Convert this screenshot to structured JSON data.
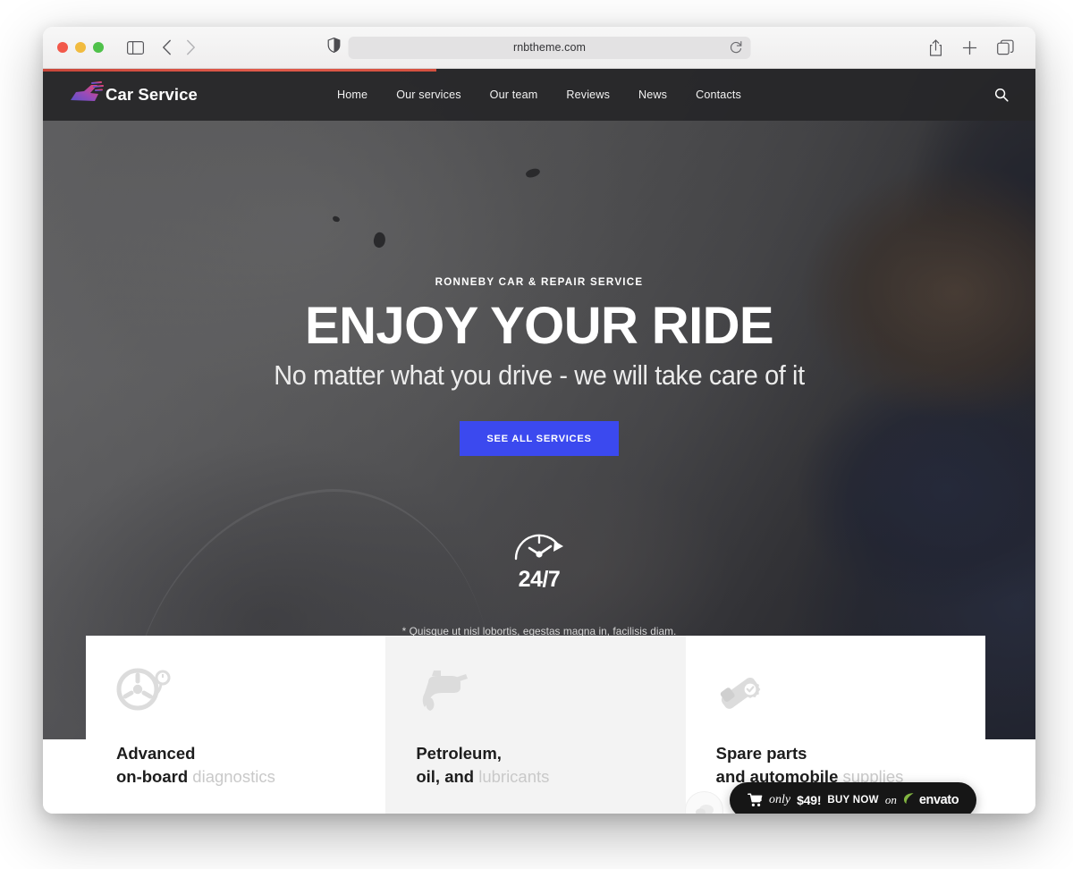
{
  "browser": {
    "url": "rnbtheme.com",
    "icons": {
      "sidebar": "sidebar-toggle-icon",
      "back": "back-chevron-icon",
      "forward": "forward-chevron-icon",
      "privacy": "privacy-report-icon",
      "reload": "reload-icon",
      "share": "share-icon",
      "new_tab": "plus-icon",
      "tabs": "tab-overview-icon"
    },
    "traffic_lights": [
      "close",
      "minimize",
      "zoom"
    ],
    "load_progress_percent": 40
  },
  "site": {
    "logo_text": "Car Service",
    "nav": [
      {
        "label": "Home"
      },
      {
        "label": "Our services"
      },
      {
        "label": "Our team"
      },
      {
        "label": "Reviews"
      },
      {
        "label": "News"
      },
      {
        "label": "Contacts"
      }
    ],
    "search_icon": "search-icon"
  },
  "hero": {
    "eyebrow": "RONNEBY CAR & REPAIR SERVICE",
    "title": "ENJOY YOUR RIDE",
    "subtitle": "No matter what you drive - we will take care of it",
    "cta_label": "SEE ALL SERVICES",
    "availability_label": "24/7",
    "availability_icon": "speedometer-clock-icon",
    "footnote": "* Quisque ut nisl lobortis, egestas magna in, facilisis diam."
  },
  "features": [
    {
      "icon": "wheel-diagnostics-icon",
      "line1_bold": "Advanced",
      "line2_bold": "on-board",
      "line2_light": "diagnostics",
      "background": "white"
    },
    {
      "icon": "oil-canister-icon",
      "line1_bold": "Petroleum,",
      "line2_bold": "oil, and",
      "line2_light": "lubricants",
      "background": "grey"
    },
    {
      "icon": "spare-parts-icon",
      "line1_bold": "Spare parts",
      "line2_bold": "and automobile",
      "line2_light": "supplies",
      "background": "white"
    }
  ],
  "widgets": {
    "chat_icon": "chat-bubble-icon",
    "purchase_badge": {
      "cart_icon": "shopping-cart-icon",
      "prefix": "only",
      "price": "$49!",
      "action": "BUY NOW",
      "connector": "on",
      "marketplace": "envato",
      "leaf_icon": "envato-leaf-icon",
      "background_color": "#161616",
      "leaf_color": "#82b541"
    }
  },
  "colors": {
    "cta_blue": "#3b49ef",
    "header_dark": "#262628",
    "card_grey": "#f3f3f3",
    "progress_red": "#d4503f"
  }
}
